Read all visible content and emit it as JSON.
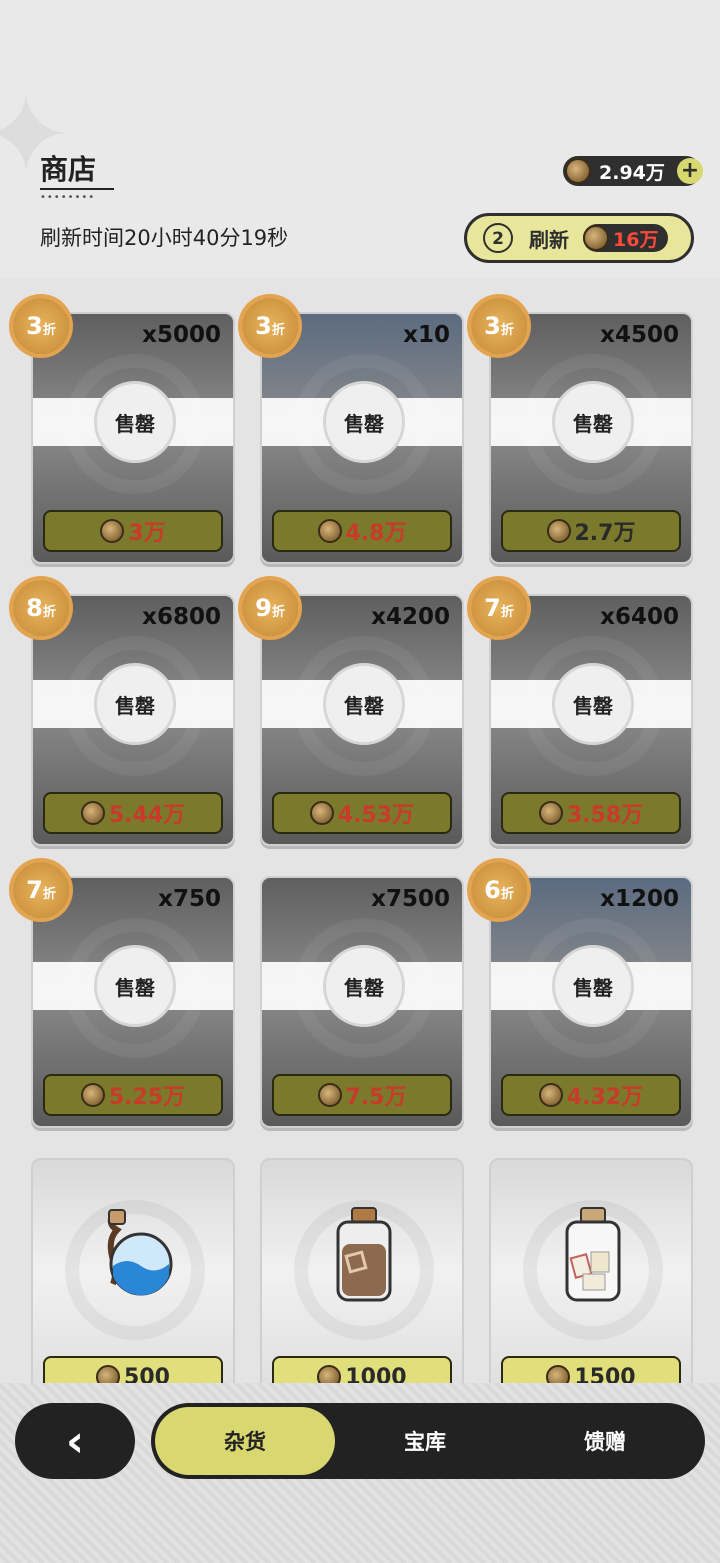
{
  "header": {
    "title": "商店",
    "refresh_time": "刷新时间20小时40分19秒",
    "currency_amount": "2.94万",
    "refresh_count": "2",
    "refresh_label": "刷新",
    "refresh_cost": "16万"
  },
  "items": [
    {
      "qty": "x5000",
      "discount": "3",
      "discount_unit": "折",
      "sold": "售罄",
      "price": "3万",
      "price_color": "red",
      "sold_out": true
    },
    {
      "qty": "x10",
      "discount": "3",
      "discount_unit": "折",
      "sold": "售罄",
      "price": "4.8万",
      "price_color": "red",
      "sold_out": true
    },
    {
      "qty": "x4500",
      "discount": "3",
      "discount_unit": "折",
      "sold": "售罄",
      "price": "2.7万",
      "price_color": "dark",
      "sold_out": true
    },
    {
      "qty": "x6800",
      "discount": "8",
      "discount_unit": "折",
      "sold": "售罄",
      "price": "5.44万",
      "price_color": "red",
      "sold_out": true
    },
    {
      "qty": "x4200",
      "discount": "9",
      "discount_unit": "折",
      "sold": "售罄",
      "price": "4.53万",
      "price_color": "red",
      "sold_out": true
    },
    {
      "qty": "x6400",
      "discount": "7",
      "discount_unit": "折",
      "sold": "售罄",
      "price": "3.58万",
      "price_color": "red",
      "sold_out": true
    },
    {
      "qty": "x750",
      "discount": "7",
      "discount_unit": "折",
      "sold": "售罄",
      "price": "5.25万",
      "price_color": "red",
      "sold_out": true
    },
    {
      "qty": "x7500",
      "discount": "",
      "discount_unit": "",
      "sold": "售罄",
      "price": "7.5万",
      "price_color": "red",
      "sold_out": true
    },
    {
      "qty": "x1200",
      "discount": "6",
      "discount_unit": "折",
      "sold": "售罄",
      "price": "4.32万",
      "price_color": "red",
      "sold_out": true
    },
    {
      "qty": "",
      "discount": "",
      "discount_unit": "",
      "sold": "",
      "price": "500",
      "price_color": "dark",
      "sold_out": false,
      "icon": "blue-potion-icon"
    },
    {
      "qty": "",
      "discount": "",
      "discount_unit": "",
      "sold": "",
      "price": "1000",
      "price_color": "dark",
      "sold_out": false,
      "icon": "brown-jar-icon"
    },
    {
      "qty": "",
      "discount": "",
      "discount_unit": "",
      "sold": "",
      "price": "1500",
      "price_color": "dark",
      "sold_out": false,
      "icon": "white-jar-icon"
    }
  ],
  "tabs": {
    "back": "‹",
    "groceries": "杂货",
    "treasury": "宝库",
    "gifts": "馈赠"
  },
  "colors": {
    "accent": "#d9d770",
    "dark": "#222222",
    "price_red": "#c83a2a"
  }
}
